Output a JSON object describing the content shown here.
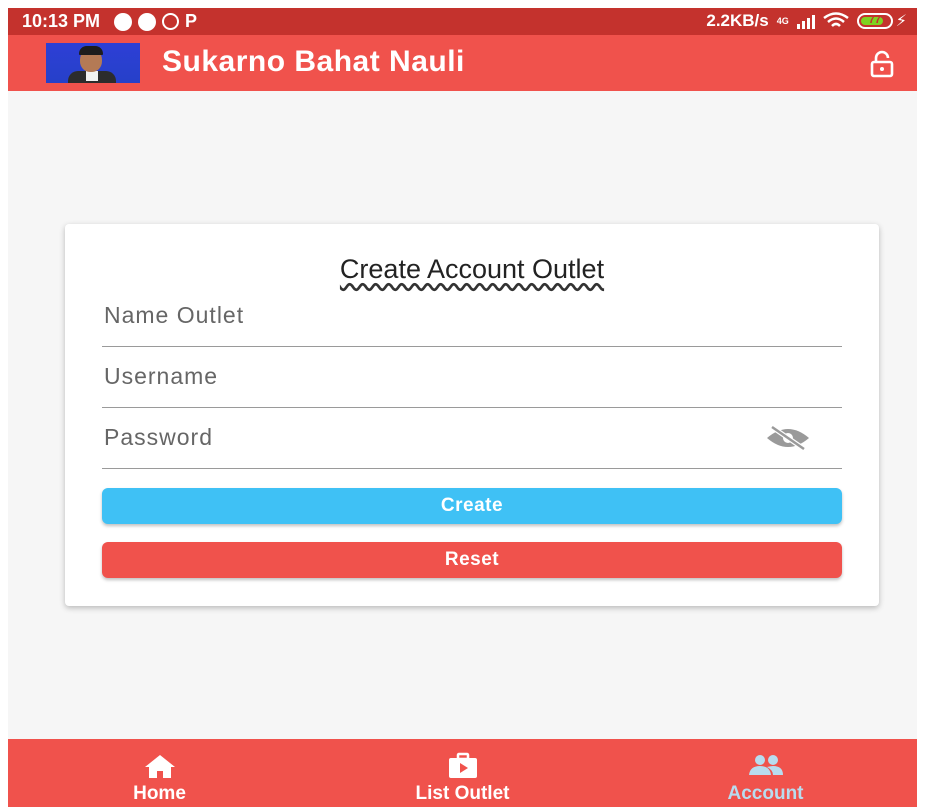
{
  "status_bar": {
    "time": "10:13 PM",
    "net_speed": "2.2KB/s",
    "network": "4G",
    "battery": "77",
    "battery_level": 0.77
  },
  "app_bar": {
    "title": "Sukarno Bahat Nauli"
  },
  "form": {
    "title": "Create Account Outlet",
    "name_placeholder": "Name Outlet",
    "username_placeholder": "Username",
    "password_placeholder": "Password",
    "create_label": "Create",
    "reset_label": "Reset"
  },
  "bottom_nav": {
    "items": [
      {
        "label": "Home",
        "icon": "home-icon"
      },
      {
        "label": "List Outlet",
        "icon": "outlet-icon"
      },
      {
        "label": "Account",
        "icon": "account-icon"
      }
    ],
    "active_index": 2
  },
  "colors": {
    "status_bar": "#c4322d",
    "primary": "#f0524c",
    "create_button": "#3fc1f5",
    "active_nav": "#b8dcef"
  }
}
